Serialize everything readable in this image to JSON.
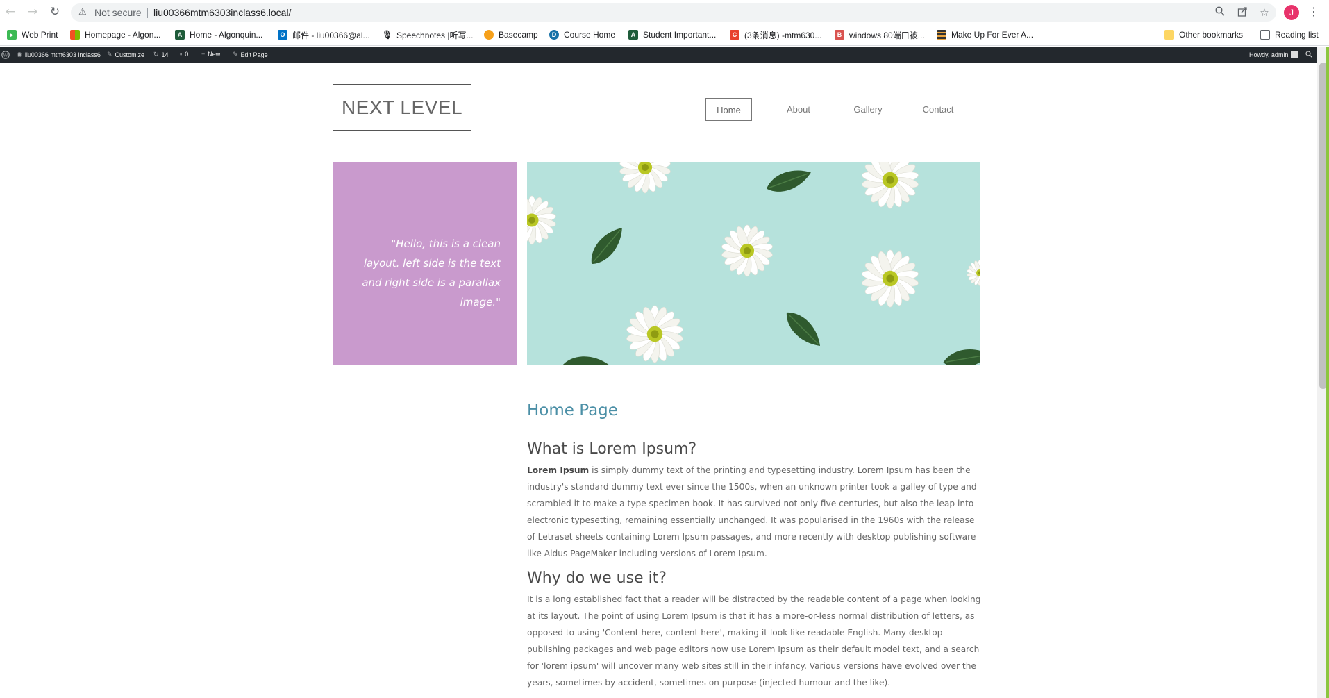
{
  "browser": {
    "not_secure_label": "Not secure",
    "url": "liu00366mtm6303inclass6.local/",
    "profile_initial": "J",
    "bookmarks": [
      {
        "label": "Web Print",
        "icon": "web-print-icon",
        "color": "#3cba54"
      },
      {
        "label": "Homepage - Algon...",
        "icon": "microsoft-icon",
        "color": "#f25022"
      },
      {
        "label": "Home - Algonquin...",
        "icon": "ac-icon",
        "color": "#1f5c3a"
      },
      {
        "label": "邮件 - liu00366@al...",
        "icon": "outlook-icon",
        "color": "#0072c6"
      },
      {
        "label": "Speechnotes |听写...",
        "icon": "microphone-icon",
        "color": "#202124"
      },
      {
        "label": "Basecamp",
        "icon": "basecamp-icon",
        "color": "#f6a01a"
      },
      {
        "label": "Course Home",
        "icon": "course-home-icon",
        "color": "#1a73a8"
      },
      {
        "label": "Student Important...",
        "icon": "ac-icon",
        "color": "#1f5c3a"
      },
      {
        "label": "(3条消息) -mtm630...",
        "icon": "csdn-icon",
        "color": "#e8412e"
      },
      {
        "label": "windows 80端口被...",
        "icon": "cnblogs-icon",
        "color": "#d9534f"
      },
      {
        "label": "Make Up For Ever A...",
        "icon": "makeup-icon",
        "color": "#333333"
      }
    ],
    "other_bookmarks": "Other bookmarks",
    "reading_list": "Reading list"
  },
  "adminbar": {
    "site_name": "liu00366 mtm6303 inclass6",
    "customize": "Customize",
    "updates_count": "14",
    "comments_count": "0",
    "new_label": "New",
    "edit_page": "Edit Page",
    "howdy": "Howdy, admin"
  },
  "site": {
    "logo": "NEXT LEVEL",
    "menu": [
      "Home",
      "About",
      "Gallery",
      "Contact"
    ]
  },
  "hero": {
    "quote": "\"Hello, this is a clean layout. left side is the text and right side is a parallax image.\"",
    "quote_bg": "#c99acd",
    "image_bg": "#b6e2dc"
  },
  "content": {
    "page_title": "Home Page",
    "h2_1": "What is Lorem Ipsum?",
    "p1_bold": "Lorem Ipsum",
    "p1_rest": " is simply dummy text of the printing and typesetting industry. Lorem Ipsum has been the industry's standard dummy text ever since the 1500s, when an unknown printer took a galley of type and scrambled it to make a type specimen book. It has survived not only five centuries, but also the leap into electronic typesetting, remaining essentially unchanged. It was popularised in the 1960s with the release of Letraset sheets containing Lorem Ipsum passages, and more recently with desktop publishing software like Aldus PageMaker including versions of Lorem Ipsum.",
    "h2_2": "Why do we use it?",
    "p2": "It is a long established fact that a reader will be distracted by the readable content of a page when looking at its layout. The point of using Lorem Ipsum is that it has a more-or-less normal distribution of letters, as opposed to using 'Content here, content here', making it look like readable English. Many desktop publishing packages and web page editors now use Lorem Ipsum as their default model text, and a search for 'lorem ipsum' will uncover many web sites still in their infancy. Various versions have evolved over the years, sometimes by accident, sometimes on purpose (injected humour and the like)."
  }
}
